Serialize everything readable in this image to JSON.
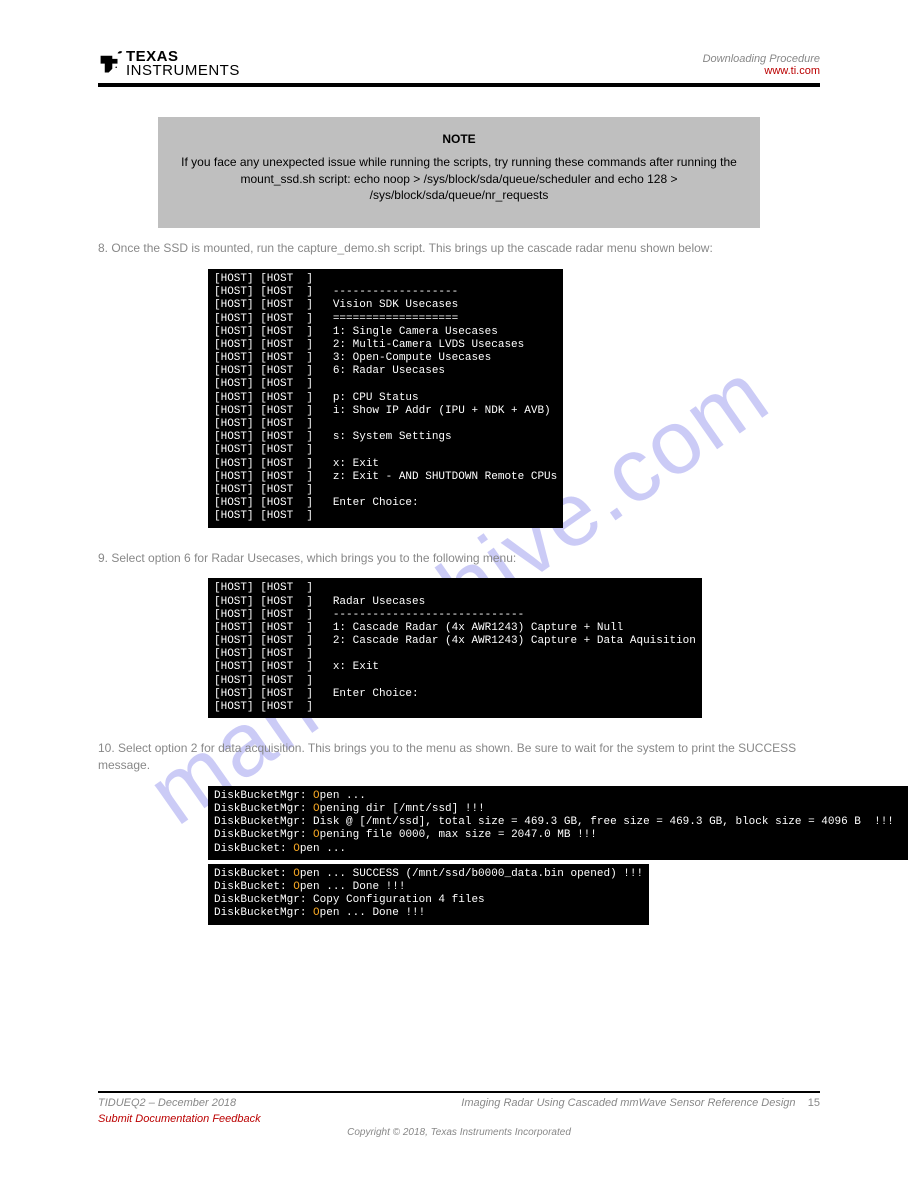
{
  "header": {
    "logo_top": "TEXAS",
    "logo_bottom": "INSTRUMENTS",
    "right_line": "Downloading Procedure"
  },
  "note": {
    "label": "NOTE",
    "text": "If you face any unexpected issue while running the scripts, try running these commands after running the mount_ssd.sh script: echo noop > /sys/block/sda/queue/scheduler and echo 128 > /sys/block/sda/queue/nr_requests"
  },
  "para1": "8. Once the SSD is mounted, run the capture_demo.sh script. This brings up the cascade radar menu shown below:",
  "term1": [
    "[HOST] [HOST  ]",
    "[HOST] [HOST  ]   -------------------",
    "[HOST] [HOST  ]   Vision SDK Usecases",
    "[HOST] [HOST  ]   ===================",
    "[HOST] [HOST  ]   1: Single Camera Usecases",
    "[HOST] [HOST  ]   2: Multi-Camera LVDS Usecases",
    "[HOST] [HOST  ]   3: Open-Compute Usecases",
    "[HOST] [HOST  ]   6: Radar Usecases",
    "[HOST] [HOST  ]",
    "[HOST] [HOST  ]   p: CPU Status",
    "[HOST] [HOST  ]   i: Show IP Addr (IPU + NDK + AVB)",
    "[HOST] [HOST  ]",
    "[HOST] [HOST  ]   s: System Settings",
    "[HOST] [HOST  ]",
    "[HOST] [HOST  ]   x: Exit",
    "[HOST] [HOST  ]   z: Exit - AND SHUTDOWN Remote CPUs",
    "[HOST] [HOST  ]",
    "[HOST] [HOST  ]   Enter Choice:",
    "[HOST] [HOST  ]"
  ],
  "para2": "9. Select option 6 for Radar Usecases, which brings you to the following menu:",
  "term2": [
    "[HOST] [HOST  ]",
    "[HOST] [HOST  ]   Radar Usecases",
    "[HOST] [HOST  ]   -----------------------------",
    "[HOST] [HOST  ]   1: Cascade Radar (4x AWR1243) Capture + Null",
    "[HOST] [HOST  ]   2: Cascade Radar (4x AWR1243) Capture + Data Aquisition",
    "[HOST] [HOST  ]",
    "[HOST] [HOST  ]   x: Exit",
    "[HOST] [HOST  ]",
    "[HOST] [HOST  ]   Enter Choice:",
    "[HOST] [HOST  ]"
  ],
  "para3": "10. Select option 2 for data acquisition. This brings you to the menu as shown. Be sure to wait for the system to print the SUCCESS message.",
  "term3a": [
    "DiskBucketMgr: Open ...",
    "DiskBucketMgr: Opening dir [/mnt/ssd] !!!",
    "DiskBucketMgr: Disk @ [/mnt/ssd], total size = 469.3 GB, free size = 469.3 GB, block size = 4096 B  !!!",
    "DiskBucketMgr: Opening file 0000, max size = 2047.0 MB !!!",
    "DiskBucket: Open ..."
  ],
  "term3b": [
    "DiskBucket: Open ... SUCCESS (/mnt/ssd/b0000_data.bin opened) !!!",
    "DiskBucket: Open ... Done !!!",
    "DiskBucketMgr: Copy Configuration 4 files",
    "DiskBucketMgr: Open ... Done !!!"
  ],
  "footer": {
    "left": "TIDUEQ2 – December 2018",
    "right_title": "Imaging Radar Using Cascaded mmWave Sensor Reference Design",
    "right_page": "15",
    "sub_left": "Submit Documentation Feedback",
    "copy": "Copyright © 2018, Texas Instruments Incorporated"
  },
  "watermark": "manualshive.com"
}
